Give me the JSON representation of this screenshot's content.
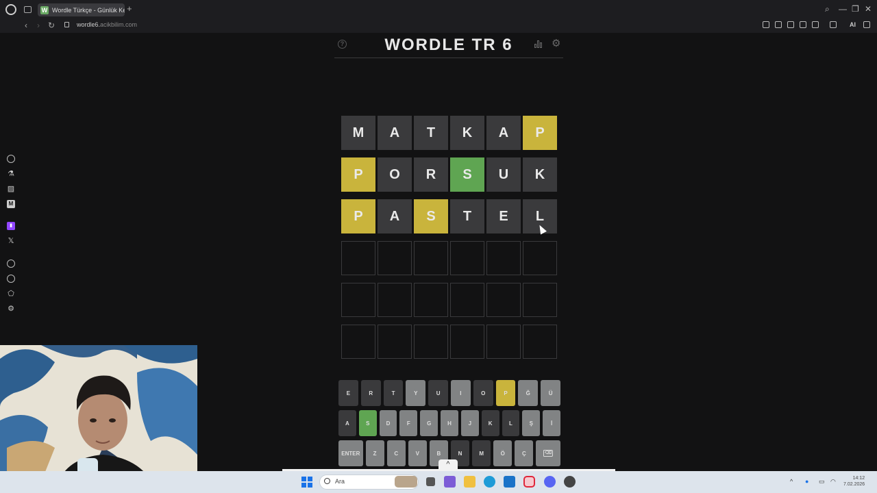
{
  "browser": {
    "tab_title": "Wordle Türkçe - Günlük Ke",
    "tab_favicon_letter": "W",
    "url_domain": "wordle6.",
    "url_rest": "acikbilim.com",
    "ai_label": "AI"
  },
  "game": {
    "title": "WORDLE TR 6",
    "board": [
      [
        {
          "l": "M",
          "s": "absent"
        },
        {
          "l": "A",
          "s": "absent"
        },
        {
          "l": "T",
          "s": "absent"
        },
        {
          "l": "K",
          "s": "absent"
        },
        {
          "l": "A",
          "s": "absent"
        },
        {
          "l": "P",
          "s": "present"
        }
      ],
      [
        {
          "l": "P",
          "s": "present"
        },
        {
          "l": "O",
          "s": "absent"
        },
        {
          "l": "R",
          "s": "absent"
        },
        {
          "l": "S",
          "s": "correct"
        },
        {
          "l": "U",
          "s": "absent"
        },
        {
          "l": "K",
          "s": "absent"
        }
      ],
      [
        {
          "l": "P",
          "s": "present"
        },
        {
          "l": "A",
          "s": "absent"
        },
        {
          "l": "S",
          "s": "present"
        },
        {
          "l": "T",
          "s": "absent"
        },
        {
          "l": "E",
          "s": "absent"
        },
        {
          "l": "L",
          "s": "absent"
        }
      ],
      [
        {
          "l": "",
          "s": "empty"
        },
        {
          "l": "",
          "s": "empty"
        },
        {
          "l": "",
          "s": "empty"
        },
        {
          "l": "",
          "s": "empty"
        },
        {
          "l": "",
          "s": "empty"
        },
        {
          "l": "",
          "s": "empty"
        }
      ],
      [
        {
          "l": "",
          "s": "empty"
        },
        {
          "l": "",
          "s": "empty"
        },
        {
          "l": "",
          "s": "empty"
        },
        {
          "l": "",
          "s": "empty"
        },
        {
          "l": "",
          "s": "empty"
        },
        {
          "l": "",
          "s": "empty"
        }
      ],
      [
        {
          "l": "",
          "s": "empty"
        },
        {
          "l": "",
          "s": "empty"
        },
        {
          "l": "",
          "s": "empty"
        },
        {
          "l": "",
          "s": "empty"
        },
        {
          "l": "",
          "s": "empty"
        },
        {
          "l": "",
          "s": "empty"
        }
      ]
    ],
    "keyboard": [
      [
        {
          "k": "E",
          "s": "absent"
        },
        {
          "k": "R",
          "s": "absent"
        },
        {
          "k": "T",
          "s": "absent"
        },
        {
          "k": "Y",
          "s": "unused"
        },
        {
          "k": "U",
          "s": "absent"
        },
        {
          "k": "I",
          "s": "unused"
        },
        {
          "k": "O",
          "s": "absent"
        },
        {
          "k": "P",
          "s": "present"
        },
        {
          "k": "Ğ",
          "s": "unused"
        },
        {
          "k": "Ü",
          "s": "unused"
        }
      ],
      [
        {
          "k": "A",
          "s": "absent"
        },
        {
          "k": "S",
          "s": "correct"
        },
        {
          "k": "D",
          "s": "unused"
        },
        {
          "k": "F",
          "s": "unused"
        },
        {
          "k": "G",
          "s": "unused"
        },
        {
          "k": "H",
          "s": "unused"
        },
        {
          "k": "J",
          "s": "unused"
        },
        {
          "k": "K",
          "s": "absent"
        },
        {
          "k": "L",
          "s": "absent"
        },
        {
          "k": "Ş",
          "s": "unused"
        },
        {
          "k": "İ",
          "s": "unused"
        }
      ],
      [
        {
          "k": "ENTER",
          "s": "unused",
          "wide": true
        },
        {
          "k": "Z",
          "s": "unused"
        },
        {
          "k": "C",
          "s": "unused"
        },
        {
          "k": "V",
          "s": "unused"
        },
        {
          "k": "B",
          "s": "unused"
        },
        {
          "k": "N",
          "s": "absent"
        },
        {
          "k": "M",
          "s": "absent"
        },
        {
          "k": "Ö",
          "s": "unused"
        },
        {
          "k": "Ç",
          "s": "unused"
        },
        {
          "k": "⌫",
          "s": "unused",
          "wide": true,
          "backspace": true
        }
      ]
    ]
  },
  "taskbar": {
    "search_placeholder": "Ara",
    "clock_time": "14:12",
    "clock_date": "7.02.2026"
  },
  "colors": {
    "correct": "#5fa552",
    "present": "#c9b43c",
    "absent": "#3a3a3c",
    "unused": "#818384",
    "background": "#121213"
  }
}
